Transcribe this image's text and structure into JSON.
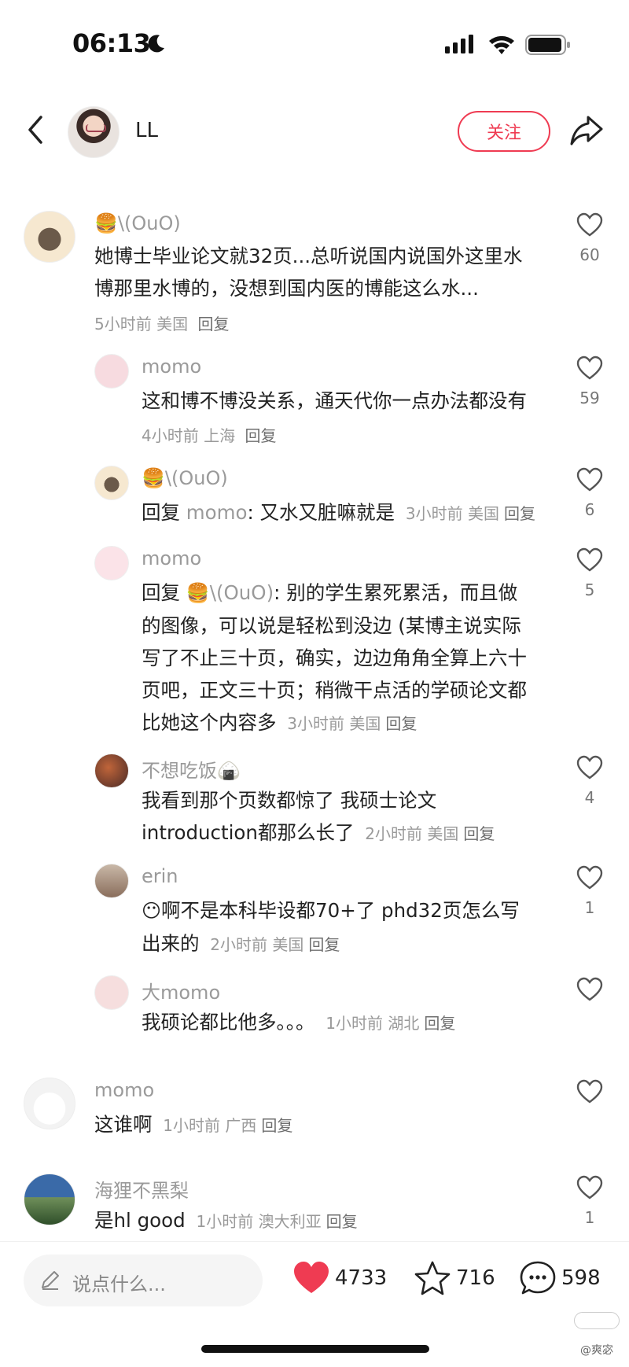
{
  "status_bar": {
    "time": "06:13"
  },
  "header": {
    "name": "LL",
    "follow_label": "关注"
  },
  "comments": [
    {
      "user": "\\(OuO)",
      "text_lines": [
        "她博士毕业论文就32页...总听说国内说国外这里水",
        "博那里水博的，没想到国内医的博能这么水..."
      ],
      "meta": "5小时前 美国",
      "reply": "回复",
      "likes": "60"
    },
    {
      "user": "momo",
      "text_lines": [
        "这和博不博没关系，通天代你一点办法都没有"
      ],
      "meta": "4小时前 上海",
      "reply": "回复",
      "likes": "59"
    },
    {
      "user": "\\(OuO)",
      "reply_prefix": "回复",
      "reply_to": "momo",
      "text_lines": [
        ": 又水又脏嘛就是"
      ],
      "meta": "3小时前 美国",
      "reply": "回复",
      "likes": "6"
    },
    {
      "user": "momo",
      "reply_prefix": "回复",
      "reply_to": "\\(OuO)",
      "text_lines": [
        ": 别的学生累死累活，而且做",
        "的图像，可以说是轻松到没边 (某博主说实际",
        "写了不止三十页，确实，边边角角全算上六十",
        "页吧，正文三十页；稍微干点活的学硕论文都",
        "比她这个内容多"
      ],
      "meta": "3小时前 美国",
      "reply": "回复",
      "likes": "5"
    },
    {
      "user": "不想吃饭",
      "text_lines": [
        "我看到那个页数都惊了 我硕士论文",
        "introduction都那么长了"
      ],
      "meta": "2小时前 美国",
      "reply": "回复",
      "likes": "4"
    },
    {
      "user": "erin",
      "text_lines": [
        "啊不是本科毕设都70+了 phd32页怎么写",
        "出来的"
      ],
      "meta": "2小时前 美国",
      "reply": "回复",
      "likes": "1"
    },
    {
      "user": "大momo",
      "text_lines": [
        "我硕论都比他多。。。"
      ],
      "meta": "1小时前 湖北",
      "reply": "回复",
      "likes": ""
    },
    {
      "user": "momo",
      "text_lines": [
        "这谁啊"
      ],
      "meta": "1小时前 广西",
      "reply": "回复",
      "likes": ""
    },
    {
      "user": "海狸不黑梨",
      "text_lines": [
        "是hl good"
      ],
      "meta": "1小时前 澳大利亚",
      "reply": "回复",
      "likes": "1"
    }
  ],
  "bottom_bar": {
    "input_placeholder": "说点什么...",
    "likes": "4733",
    "favorites": "716",
    "comments": "598"
  },
  "watermark": "@爽宓",
  "colors": {
    "accent": "#ef3b52",
    "muted": "#9a9a9a"
  }
}
